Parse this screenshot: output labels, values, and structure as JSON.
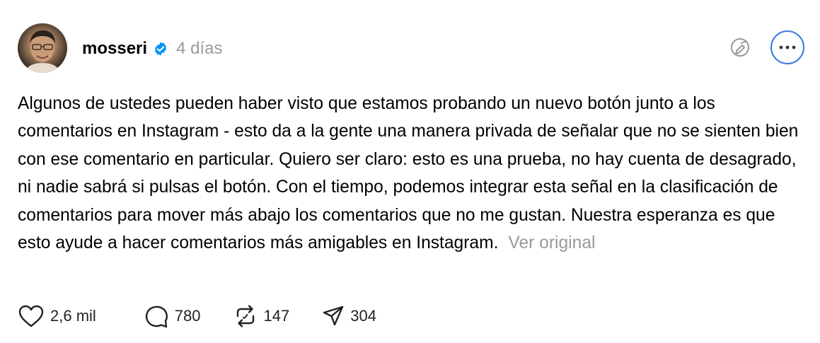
{
  "post": {
    "author": {
      "username": "mosseri",
      "verified": true,
      "avatar_icon": "profile-photo"
    },
    "time_ago": "4 días",
    "text": "Algunos de ustedes pueden haber visto que estamos probando un nuevo botón junto a los comentarios en Instagram - esto da a la gente una manera privada de señalar que no se sienten bien con ese comentario en particular. Quiero ser claro: esto es una prueba, no hay cuenta de desagrado, ni nadie sabrá si pulsas el botón. Con el tiempo, podemos integrar esta señal en la clasificación de comentarios para mover más abajo los comentarios que no me gustan. Nuestra esperanza es que esto ayude a hacer comentarios más amigables en Instagram.",
    "see_original_label": "Ver original",
    "actions": {
      "likes": "2,6 mil",
      "comments": "780",
      "reposts": "147",
      "shares": "304"
    }
  },
  "colors": {
    "verified_badge": "#0095f6",
    "muted_text": "#999999",
    "focus_ring": "#3a7be0"
  },
  "icons": [
    "verified-badge-icon",
    "translate-icon",
    "more-icon",
    "heart-icon",
    "comment-icon",
    "repost-icon",
    "share-icon"
  ]
}
